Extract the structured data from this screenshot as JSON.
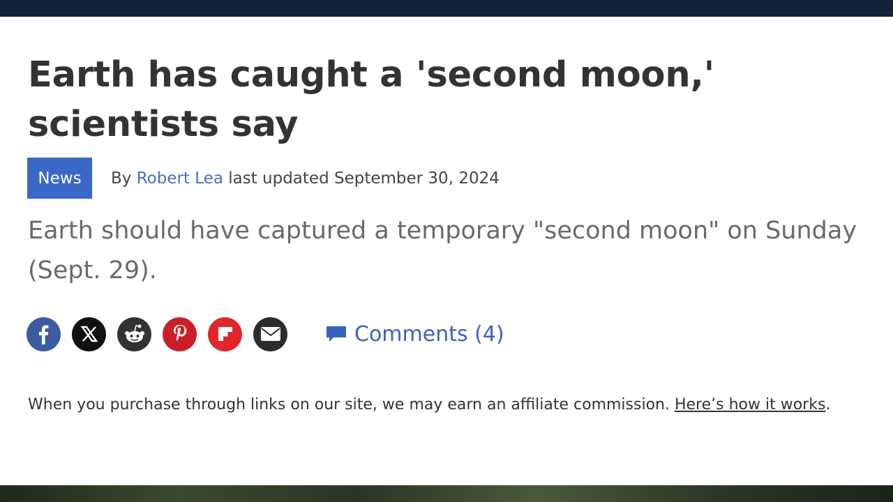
{
  "article": {
    "headline": "Earth has caught a 'second moon,' scientists say",
    "category": "News",
    "by_label": "By",
    "author": "Robert Lea",
    "updated_label": "last updated",
    "date": "September 30, 2024",
    "subheadline": "Earth should have captured a temporary \"second moon\" on Sunday (Sept. 29)."
  },
  "share": {
    "buttons": [
      {
        "icon": "facebook-icon",
        "color": "#3b5c9f"
      },
      {
        "icon": "x-icon",
        "color": "#111111"
      },
      {
        "icon": "reddit-icon",
        "color": "#333333"
      },
      {
        "icon": "pinterest-icon",
        "color": "#cb1f27"
      },
      {
        "icon": "flipboard-icon",
        "color": "#e2262c"
      },
      {
        "icon": "email-icon",
        "color": "#2b2b2b"
      }
    ],
    "comments_label": "Comments (4)"
  },
  "disclaimer": {
    "text": "When you purchase through links on our site, we may earn an affiliate commission. ",
    "link_text": "Here’s how it works",
    "end": "."
  },
  "colors": {
    "badge": "#3a68c8",
    "link": "#4a6fc0",
    "top_bar": "#15233a"
  }
}
